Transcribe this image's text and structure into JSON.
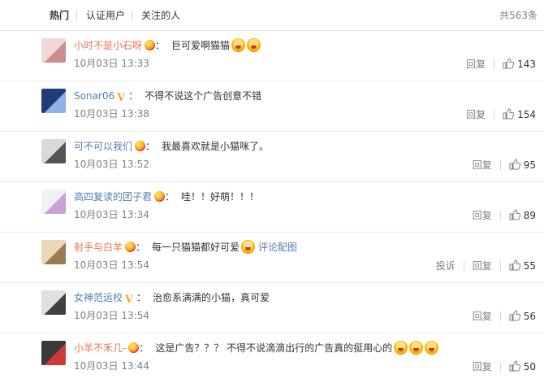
{
  "tabs": [
    {
      "label": "热门",
      "active": true
    },
    {
      "label": "认证用户",
      "active": false
    },
    {
      "label": "关注的人",
      "active": false
    }
  ],
  "total": "共563条",
  "colors": {
    "accent_name": "#eb7350",
    "link": "#507daf",
    "muted": "#808080"
  },
  "comments": [
    {
      "user": "小时不是小石呀",
      "badge": "vip",
      "text": "巨可爱啊猫猫",
      "emoji_count": 2,
      "time": "10月03日 13:33",
      "reply": "回复",
      "likes": "143"
    },
    {
      "user": "Sonar06",
      "badge": "v",
      "text": "不得不说这个广告创意不错",
      "emoji_count": 0,
      "time": "10月03日 13:38",
      "reply": "回复",
      "likes": "154"
    },
    {
      "user": "可不可以我们",
      "badge": "vip",
      "text": "我最喜欢就是小猫咪了。",
      "emoji_count": 0,
      "time": "10月03日 13:52",
      "reply": "回复",
      "likes": "95"
    },
    {
      "user": "高四复读的团子君",
      "badge": "vip",
      "text": "哇！！好萌！！！",
      "emoji_count": 0,
      "time": "10月03日 13:34",
      "reply": "回复",
      "likes": "89"
    },
    {
      "user": "射手与白羊",
      "badge": "vip",
      "text": "每一只猫猫都好可爱",
      "emoji_count": 1,
      "link": "评论配图",
      "time": "10月03日 13:54",
      "report": "投诉",
      "reply": "回复",
      "likes": "55"
    },
    {
      "user": "女神范运校",
      "badge": "v",
      "text": "治愈系满满的小猫，真可爱",
      "emoji_count": 0,
      "time": "10月03日 13:54",
      "reply": "回复",
      "likes": "56"
    },
    {
      "user": "小羊不禾几-",
      "badge": "vip",
      "text": "这是广告？？？ 不得不说滴滴出行的广告真的挺用心的",
      "emoji_count": 3,
      "time": "10月03日 13:44",
      "reply": "回复",
      "likes": "50"
    }
  ]
}
